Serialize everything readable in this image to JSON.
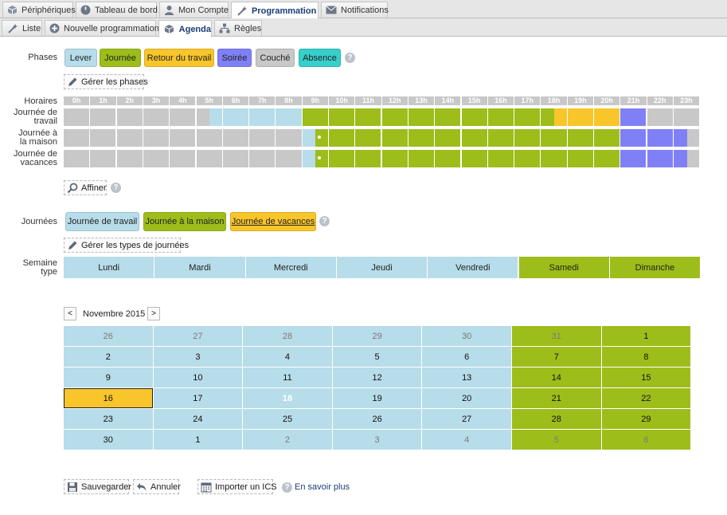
{
  "main_tabs": [
    {
      "label": "Périphériques",
      "icon": "device-cube-icon",
      "active": false
    },
    {
      "label": "Tableau de bord",
      "icon": "dashboard-gauge-icon",
      "active": false
    },
    {
      "label": "Mon Compte",
      "icon": "user-icon",
      "active": false
    },
    {
      "label": "Programmation",
      "icon": "magic-wand-icon",
      "active": true
    },
    {
      "label": "Notifications",
      "icon": "envelope-icon",
      "active": false
    }
  ],
  "sub_tabs": [
    {
      "label": "Liste",
      "icon": "magic-wand-icon",
      "active": false
    },
    {
      "label": "Nouvelle programmation",
      "icon": "plus-circle-icon",
      "active": false
    },
    {
      "label": "Agenda",
      "icon": "cube-icon",
      "active": true
    },
    {
      "label": "Règles",
      "icon": "hierarchy-icon",
      "active": false
    }
  ],
  "colors": {
    "lever": "#b7dcea",
    "journee": "#9dbd1a",
    "retour": "#f8c52a",
    "soiree": "#8080f6",
    "couche": "#c8c8c8",
    "absence": "#36cfcb"
  },
  "phases": {
    "label": "Phases",
    "items": [
      {
        "label": "Lever",
        "key": "lever"
      },
      {
        "label": "Journée",
        "key": "journee"
      },
      {
        "label": "Retour du travail",
        "key": "retour"
      },
      {
        "label": "Soirée",
        "key": "soiree"
      },
      {
        "label": "Couché",
        "key": "couche"
      },
      {
        "label": "Absence",
        "key": "absence"
      }
    ],
    "manage_button": "Gérer les phases",
    "help": "?"
  },
  "schedule": {
    "hours_label": "Horaires",
    "hours": [
      "0h",
      "1h",
      "2h",
      "3h",
      "4h",
      "5h",
      "6h",
      "7h",
      "8h",
      "9h",
      "10h",
      "11h",
      "12h",
      "13h",
      "14h",
      "15h",
      "16h",
      "17h",
      "18h",
      "19h",
      "20h",
      "21h",
      "22h",
      "23h"
    ],
    "rows": [
      {
        "label_lines": [
          "Journée de",
          "travail"
        ],
        "slots": [
          "couche",
          "couche",
          "couche",
          "couche",
          "couche",
          "couche",
          "couche",
          "couche",
          "couche",
          "couche",
          "couche",
          "lever",
          "lever",
          "lever",
          "lever",
          "lever",
          "lever",
          "lever",
          "journee",
          "journee",
          "journee",
          "journee",
          "journee",
          "journee",
          "journee",
          "journee",
          "journee",
          "journee",
          "journee",
          "journee",
          "journee",
          "journee",
          "journee",
          "journee",
          "journee",
          "journee",
          "journee",
          "retour",
          "retour",
          "retour",
          "retour",
          "retour",
          "soiree",
          "soiree",
          "couche",
          "couche",
          "couche",
          "couche"
        ]
      },
      {
        "label_lines": [
          "Journée à",
          "la maison"
        ],
        "slots": [
          "couche",
          "couche",
          "couche",
          "couche",
          "couche",
          "couche",
          "couche",
          "couche",
          "couche",
          "couche",
          "couche",
          "couche",
          "couche",
          "couche",
          "couche",
          "couche",
          "couche",
          "couche",
          "lever",
          "journee",
          "journee",
          "journee",
          "journee",
          "journee",
          "journee",
          "journee",
          "journee",
          "journee",
          "journee",
          "journee",
          "journee",
          "journee",
          "journee",
          "journee",
          "journee",
          "journee",
          "journee",
          "journee",
          "journee",
          "journee",
          "journee",
          "journee",
          "soiree",
          "soiree",
          "soiree",
          "soiree",
          "soiree",
          "couche"
        ]
      },
      {
        "label_lines": [
          "Journée de",
          "vacances"
        ],
        "slots": [
          "couche",
          "couche",
          "couche",
          "couche",
          "couche",
          "couche",
          "couche",
          "couche",
          "couche",
          "couche",
          "couche",
          "couche",
          "couche",
          "couche",
          "couche",
          "couche",
          "couche",
          "couche",
          "lever",
          "journee",
          "journee",
          "journee",
          "journee",
          "journee",
          "journee",
          "journee",
          "journee",
          "journee",
          "journee",
          "journee",
          "journee",
          "journee",
          "journee",
          "journee",
          "journee",
          "journee",
          "journee",
          "journee",
          "journee",
          "journee",
          "journee",
          "journee",
          "soiree",
          "soiree",
          "soiree",
          "soiree",
          "soiree",
          "couche"
        ]
      }
    ],
    "refine_button": "Affiner",
    "help": "?"
  },
  "journees": {
    "label": "Journées",
    "items": [
      {
        "label": "Journée de travail",
        "key": "lever",
        "underline": false
      },
      {
        "label": "Journée à la maison",
        "key": "journee",
        "underline": false
      },
      {
        "label": "Journée de vacances",
        "key": "retour",
        "underline": true
      }
    ],
    "manage_button": "Gérer les types de journées",
    "help": "?"
  },
  "week": {
    "label_lines": [
      "Semaine",
      "type"
    ],
    "days": [
      {
        "label": "Lundi",
        "key": "lever"
      },
      {
        "label": "Mardi",
        "key": "lever"
      },
      {
        "label": "Mercredi",
        "key": "lever"
      },
      {
        "label": "Jeudi",
        "key": "lever"
      },
      {
        "label": "Vendredi",
        "key": "lever"
      },
      {
        "label": "Samedi",
        "key": "journee"
      },
      {
        "label": "Dimanche",
        "key": "journee"
      }
    ]
  },
  "calendar": {
    "prev": "<",
    "next": ">",
    "month": "Novembre 2015",
    "weeks": [
      [
        {
          "d": "26",
          "key": "lever",
          "muted": true
        },
        {
          "d": "27",
          "key": "lever",
          "muted": true
        },
        {
          "d": "28",
          "key": "lever",
          "muted": true
        },
        {
          "d": "29",
          "key": "lever",
          "muted": true
        },
        {
          "d": "30",
          "key": "lever",
          "muted": true
        },
        {
          "d": "31",
          "key": "journee",
          "muted": true
        },
        {
          "d": "1",
          "key": "journee"
        }
      ],
      [
        {
          "d": "2",
          "key": "lever"
        },
        {
          "d": "3",
          "key": "lever"
        },
        {
          "d": "4",
          "key": "lever"
        },
        {
          "d": "5",
          "key": "lever"
        },
        {
          "d": "6",
          "key": "lever"
        },
        {
          "d": "7",
          "key": "journee"
        },
        {
          "d": "8",
          "key": "journee"
        }
      ],
      [
        {
          "d": "9",
          "key": "lever"
        },
        {
          "d": "10",
          "key": "lever"
        },
        {
          "d": "11",
          "key": "lever"
        },
        {
          "d": "12",
          "key": "lever"
        },
        {
          "d": "13",
          "key": "lever"
        },
        {
          "d": "14",
          "key": "journee"
        },
        {
          "d": "15",
          "key": "journee"
        }
      ],
      [
        {
          "d": "16",
          "key": "retour",
          "selected": true
        },
        {
          "d": "17",
          "key": "lever"
        },
        {
          "d": "18",
          "key": "lever",
          "today": true
        },
        {
          "d": "19",
          "key": "lever"
        },
        {
          "d": "20",
          "key": "lever"
        },
        {
          "d": "21",
          "key": "journee"
        },
        {
          "d": "22",
          "key": "journee"
        }
      ],
      [
        {
          "d": "23",
          "key": "lever"
        },
        {
          "d": "24",
          "key": "lever"
        },
        {
          "d": "25",
          "key": "lever"
        },
        {
          "d": "26",
          "key": "lever"
        },
        {
          "d": "27",
          "key": "lever"
        },
        {
          "d": "28",
          "key": "journee"
        },
        {
          "d": "29",
          "key": "journee"
        }
      ],
      [
        {
          "d": "30",
          "key": "lever"
        },
        {
          "d": "1",
          "key": "lever"
        },
        {
          "d": "2",
          "key": "lever",
          "muted": true
        },
        {
          "d": "3",
          "key": "lever",
          "muted": true
        },
        {
          "d": "4",
          "key": "lever",
          "muted": true
        },
        {
          "d": "5",
          "key": "journee",
          "muted": true
        },
        {
          "d": "6",
          "key": "journee",
          "muted": true
        }
      ]
    ]
  },
  "footer": {
    "save": "Sauvegarder",
    "cancel": "Annuler",
    "import": "Importer un ICS",
    "more": "En savoir plus",
    "help": "?"
  }
}
